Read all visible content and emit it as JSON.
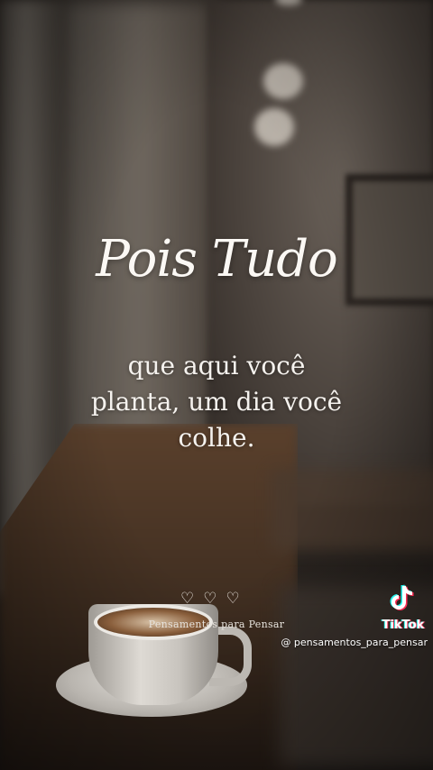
{
  "quote": {
    "title": "Pois Tudo",
    "line1": "que aqui você",
    "line2": "planta, um dia você",
    "line3": "colhe."
  },
  "footer": {
    "hearts": [
      "♡",
      "♡",
      "♡"
    ],
    "brand": "Pensamentos para Pensar"
  },
  "watermark": {
    "platform": "TikTok",
    "username": "@ pensamentos_para_pensar",
    "icon": "tiktok-logo-icon"
  },
  "colors": {
    "text": "#fbf8f4",
    "tiktok_cyan": "#25f4ee",
    "tiktok_red": "#ff2d55"
  }
}
